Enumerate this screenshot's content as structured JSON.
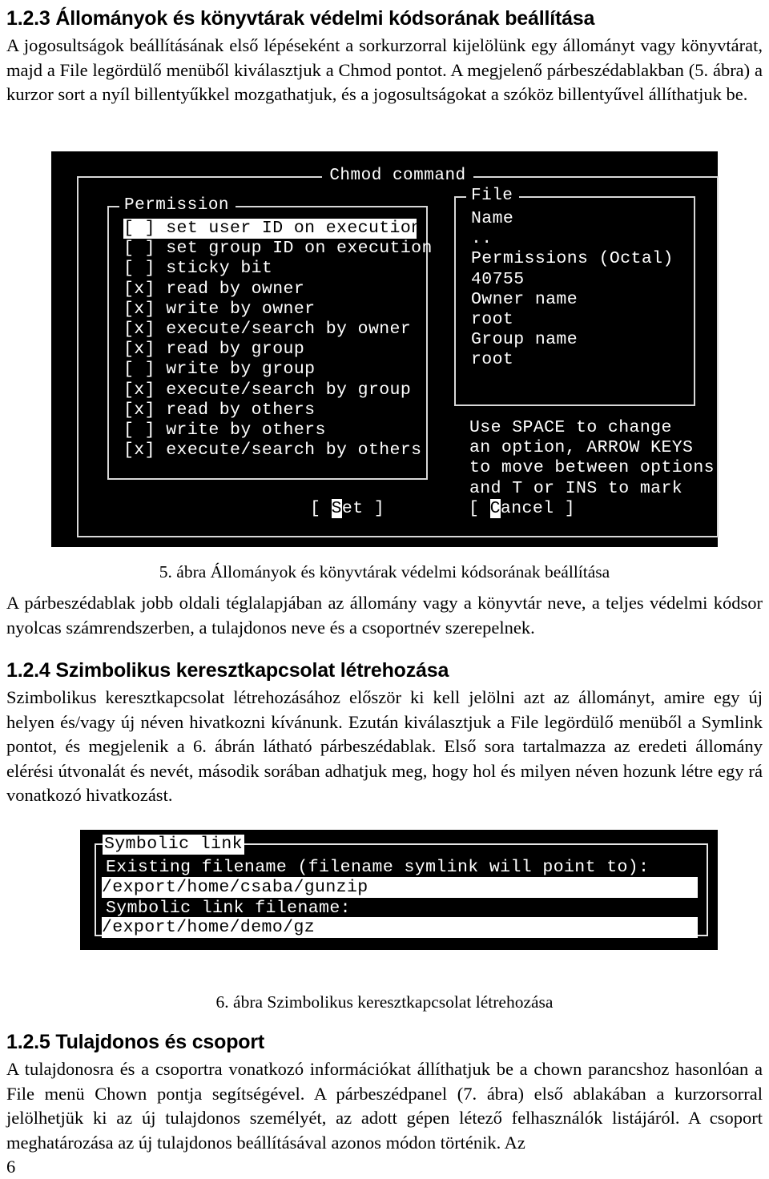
{
  "document": {
    "page_number": "6",
    "sections": [
      {
        "heading": "1.2.3 Állományok és könyvtárak védelmi kódsorának beállítása",
        "paragraph": "A jogosultságok beállításának első lépéseként a sorkurzorral kijelölünk egy állományt vagy könyvtárat, majd a File legördülő menüből kiválasztjuk a Chmod pontot. A megjelenő párbeszédablakban (5. ábra) a kurzor sort a nyíl billentyűkkel mozgathatjuk, és a jogosultságokat a szóköz billentyűvel állíthatjuk be."
      },
      {
        "heading": "1.2.4 Szimbolikus keresztkapcsolat létrehozása",
        "paragraph": "Szimbolikus keresztkapcsolat létrehozásához először ki kell jelölni azt az állományt, amire egy új helyen és/vagy új néven hivatkozni kívánunk. Ezután kiválasztjuk a File legördülő menüből a Symlink pontot, és megjelenik a 6. ábrán látható párbeszédablak. Első sora tartalmazza az eredeti állomány elérési útvonalát és nevét, második sorában adhatjuk meg, hogy hol és milyen néven hozunk létre egy rá vonatkozó hivatkozást."
      },
      {
        "heading": "1.2.5 Tulajdonos és csoport",
        "paragraph": "A tulajdonosra és a csoportra vonatkozó információkat állíthatjuk be a chown parancshoz hasonlóan a File menü Chown pontja segítségével. A párbeszédpanel (7. ábra) első ablakában a kurzorsorral jelölhetjük ki az új tulajdonos személyét, az adott gépen létező felhasználók listájáról. A csoport meghatározása az új tulajdonos beállításával azonos módon történik. Az"
      }
    ],
    "figures": [
      {
        "caption": "5. ábra Állományok és könyvtárak védelmi kódsorának beállítása"
      },
      {
        "caption": "6. ábra Szimbolikus keresztkapcsolat létrehozása"
      }
    ],
    "figure_between_caption": "A párbeszédablak jobb oldali téglalapjában az állomány vagy a könyvtár neve, a teljes védelmi kódsor nyolcas számrendszerben, a tulajdonos neve és a csoportnév szerepelnek."
  },
  "chmod_dialog": {
    "title": "Chmod command",
    "permission_legend": "Permission",
    "permissions": [
      {
        "box": "[ ]",
        "label": "set user ID on execution",
        "checked": false,
        "selected": true
      },
      {
        "box": "[ ]",
        "label": "set group ID on execution",
        "checked": false,
        "selected": false
      },
      {
        "box": "[ ]",
        "label": "sticky bit",
        "checked": false,
        "selected": false
      },
      {
        "box": "[x]",
        "label": "read by owner",
        "checked": true,
        "selected": false
      },
      {
        "box": "[x]",
        "label": "write by owner",
        "checked": true,
        "selected": false
      },
      {
        "box": "[x]",
        "label": "execute/search by owner",
        "checked": true,
        "selected": false
      },
      {
        "box": "[x]",
        "label": "read by group",
        "checked": true,
        "selected": false
      },
      {
        "box": "[ ]",
        "label": "write by group",
        "checked": false,
        "selected": false
      },
      {
        "box": "[x]",
        "label": "execute/search by group",
        "checked": true,
        "selected": false
      },
      {
        "box": "[x]",
        "label": "read by others",
        "checked": true,
        "selected": false
      },
      {
        "box": "[ ]",
        "label": "write by others",
        "checked": false,
        "selected": false
      },
      {
        "box": "[x]",
        "label": "execute/search by others",
        "checked": true,
        "selected": false
      }
    ],
    "permission_rows": [
      "[ ] set user ID on execution",
      "[ ] set group ID on execution",
      "[ ] sticky bit",
      "[x] read by owner",
      "[x] write by owner",
      "[x] execute/search by owner",
      "[x] read by group",
      "[ ] write by group",
      "[x] execute/search by group",
      "[x] read by others",
      "[ ] write by others",
      "[x] execute/search by others"
    ],
    "file_legend": "File",
    "file_info": [
      "Name",
      "..",
      "Permissions (Octal)",
      "40755",
      "Owner name",
      "root",
      "Group name",
      "root"
    ],
    "hint_lines": [
      "Use SPACE to change",
      "an option, ARROW KEYS",
      "to move between options",
      "and T or INS to mark"
    ],
    "buttons": {
      "set": {
        "prefix": "[ ",
        "hot": "S",
        "rest": "et ]"
      },
      "cancel": {
        "prefix": "[ ",
        "hot": "C",
        "rest": "ancel ]"
      }
    }
  },
  "symlink_dialog": {
    "title": "Symbolic link",
    "existing_label": "Existing filename (filename symlink will point to):",
    "existing_value": "/export/home/csaba/gunzip",
    "link_label": "Symbolic link filename:",
    "link_value": "/export/home/demo/gz"
  }
}
